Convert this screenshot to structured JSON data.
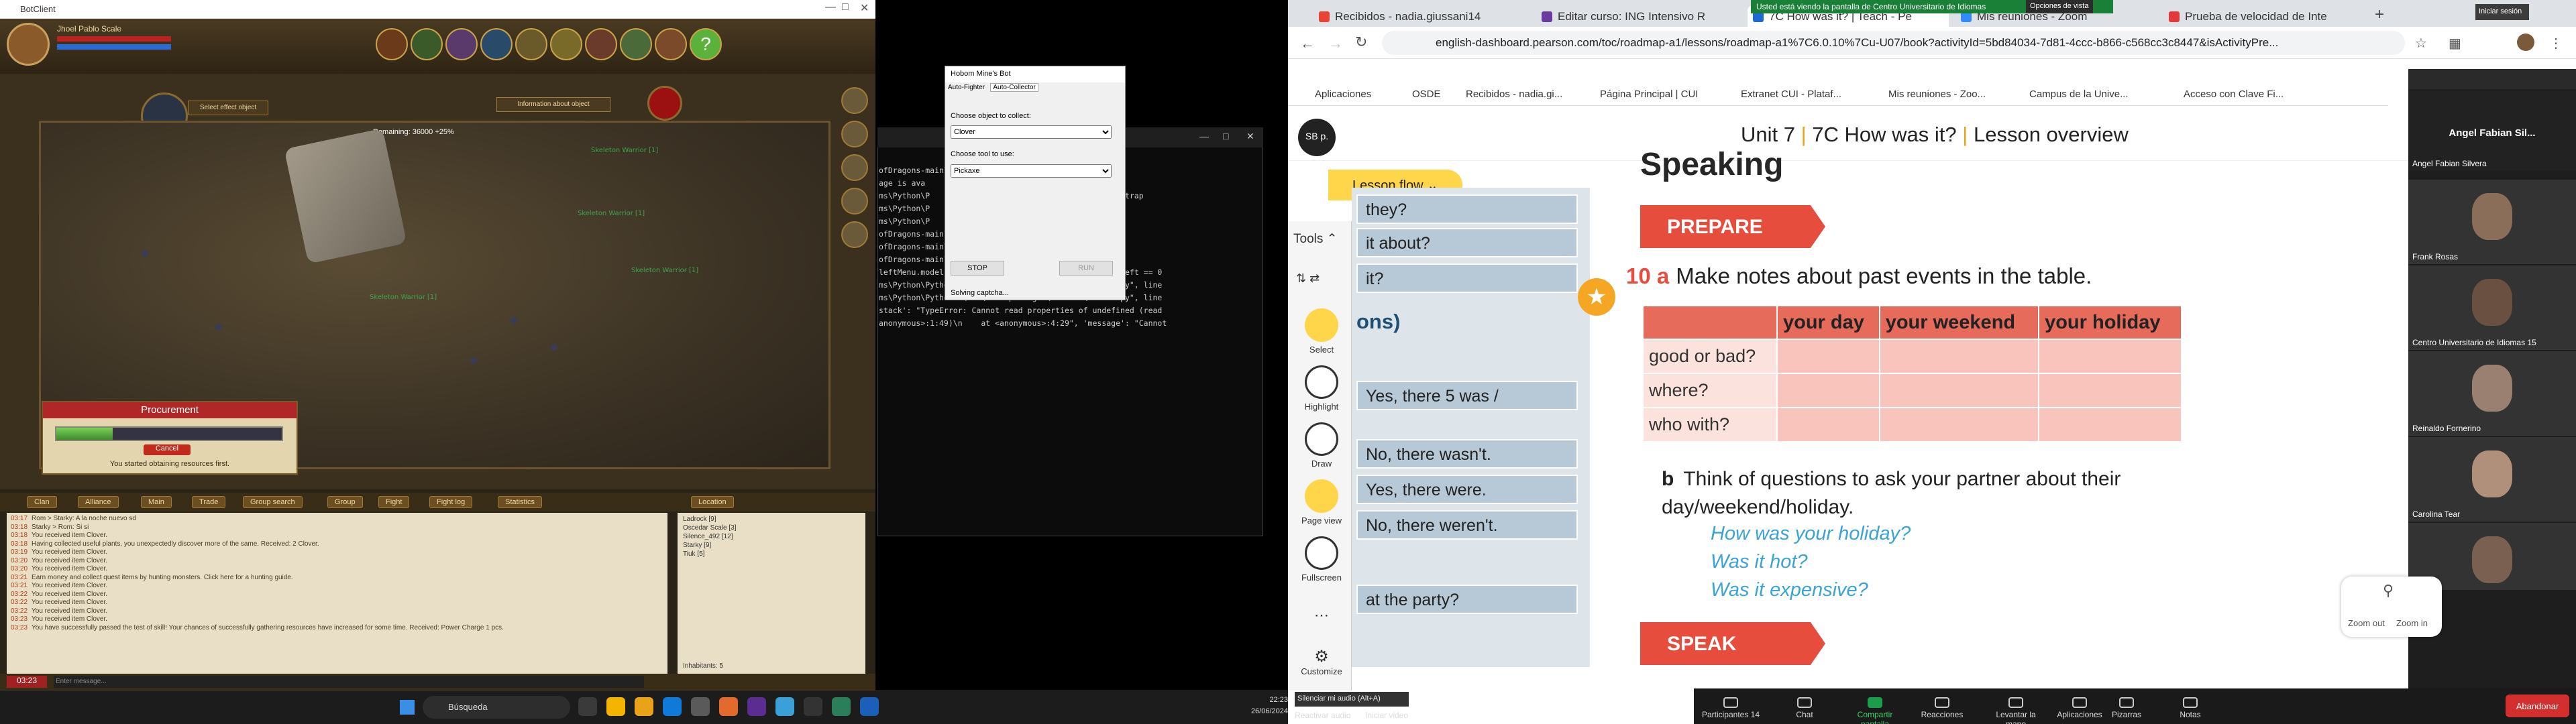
{
  "game": {
    "title": "BotClient",
    "player_name": "Jhoel Pablo Scale",
    "remaining": "Remaining: 36000 +25%",
    "select_object": "Select effect object",
    "info_object": "Information about object",
    "enemies": [
      "Skeleton Warrior [1]",
      "Skeleton Warrior [1]",
      "Skeleton Warrior [1]",
      "Skeleton Warrior [1]"
    ],
    "procurement": {
      "title": "Procurement",
      "cancel": "Cancel",
      "message": "You started obtaining resources first.",
      "progress": 0.25
    },
    "chat_tabs": [
      "Clan",
      "Alliance",
      "Main",
      "Trade",
      "Group search",
      "Group",
      "Fight",
      "Fight log",
      "Statistics",
      "Location"
    ],
    "chat_lines": [
      {
        "time": "03:17",
        "text": "Rom > Starky: A la noche nuevo sd"
      },
      {
        "time": "03:18",
        "text": "Starky > Rom: Si si"
      },
      {
        "time": "03:18",
        "text": "You received item Clover."
      },
      {
        "time": "03:18",
        "text": "Having collected useful plants, you unexpectedly discover more of the same. Received: 2 Clover."
      },
      {
        "time": "03:19",
        "text": "You received item Clover."
      },
      {
        "time": "03:20",
        "text": "You received item Clover."
      },
      {
        "time": "03:20",
        "text": "You received item Clover."
      },
      {
        "time": "03:21",
        "text": "Earn money and collect quest items by hunting monsters. Click here for a hunting guide."
      },
      {
        "time": "03:21",
        "text": "You received item Clover."
      },
      {
        "time": "03:22",
        "text": "You received item Clover."
      },
      {
        "time": "03:22",
        "text": "You received item Clover."
      },
      {
        "time": "03:22",
        "text": "You received item Clover."
      },
      {
        "time": "03:23",
        "text": "You received item Clover."
      },
      {
        "time": "03:23",
        "text": "You have successfully passed the test of skill! Your chances of successfully gathering resources have increased for some time. Received: Power Charge 1 pcs."
      }
    ],
    "location_list": [
      "Ladrock [9]",
      "Oscedar Scale [3]",
      "Silence_492 [12]",
      "Starky [9]",
      "Tiuk [5]"
    ],
    "inhabitants": "Inhabitants: 5",
    "clock": "03:23",
    "message_placeholder": "Enter message..."
  },
  "bot": {
    "title": "Hobom Mine's Bot",
    "tabs": [
      "Auto-Fighter",
      "Auto-Collector"
    ],
    "collect_label": "Choose object to collect:",
    "collect_value": "Clover",
    "tool_label": "Choose tool to use:",
    "tool_value": "Pickaxe",
    "stop": "STOP",
    "run": "RUN",
    "status": "Solving captcha..."
  },
  "terminal": {
    "lines": [
      "ofDragons-main\\botAlgo.py\", line   captureWin",
      "age is ava",
      "",
      "ms\\Python\\P                          e 973, in _bootstrap",
      "",
      "ms\\Python\\P                          e 910, in run",
      "",
      "ms\\Python\\P                     , in main_loop",
      "ofDragons-main\\botAlgo.py\", line 85, in next",
      "ofDragons-main\\botAlgo.py\", line 246, in fight",
      "ofDragons-main\\botAlgo.py\", line 256, in potReady",
      "leftMenu.model.items['\" + str(self.nextPot) + \"'].cdLeft == 0",
      "ms\\Python\\Python39\\lib\\site-packages\\webview\\window.py\", line",
      "",
      "ms\\Python\\Python39\\lib\\site-packages\\webview\\window.py\", line",
      "",
      "stack': \"TypeError: Cannot read properties of undefined (read",
      "anonymous>:1:49)\\n    at <anonymous>:4:29\", 'message': \"Cannot"
    ]
  },
  "taskbar": {
    "search": "Búsqueda",
    "time": "22:23",
    "date": "26/06/2024"
  },
  "browser": {
    "tabs": [
      "Recibidos - nadia.giussani14",
      "Editar curso: ING Intensivo R",
      "7C How was it? | Teach - Pe",
      "Mis reuniones - Zoom",
      "Prueba de velocidad de Inte"
    ],
    "share_banner": "Usted está viendo la pantalla de Centro Universitario de Idiomas",
    "share_options": "Opciones de vista",
    "login": "Iniciar sesión",
    "url": "english-dashboard.pearson.com/toc/roadmap-a1/lessons/roadmap-a1%7C6.0.10%7Cu-U07/book?activityId=5bd84034-7d81-4ccc-b866-c568cc3c8447&isActivityPre...",
    "bookmarks": [
      "Aplicaciones",
      "OSDE",
      "Recibidos - nadia.gi...",
      "Página Principal | CUI",
      "Extranet CUI - Plataf...",
      "Mis reuniones - Zoo...",
      "Campus de la Unive...",
      "Acceso con Clave Fi..."
    ]
  },
  "lesson": {
    "unit": "Unit 7",
    "section": "7C How was it?",
    "overview": "Lesson overview",
    "flow": "Lesson flow",
    "tools": "Tools",
    "tool_items": [
      "Select",
      "Highlight",
      "Draw",
      "Page view",
      "Fullscreen",
      "Customize"
    ],
    "left_cells": [
      "they?",
      "it about?",
      "it?",
      "Yes, there 5 was /",
      "No, there wasn't.",
      "Yes, there were.",
      "No, there weren't.",
      "at the party?"
    ],
    "left_heading": "ons)",
    "heading": "Speaking",
    "prepare": "PREPARE",
    "speak": "SPEAK",
    "q10_num": "10 a",
    "q10_text": "Make notes about past events in the table.",
    "table_headers": [
      "",
      "your day",
      "your weekend",
      "your holiday"
    ],
    "table_rows": [
      "good or bad?",
      "where?",
      "who with?"
    ],
    "qb_label": "b",
    "qb_text": "Think of questions to ask your partner about their day/weekend/holiday.",
    "examples": [
      "How was your holiday?",
      "Was it hot?",
      "Was it expensive?"
    ]
  },
  "zoom": {
    "participants": [
      "Angel Fabian Sil...",
      "Angel Fabian Silvera",
      "Frank Rosas",
      "Centro Universitario de Idiomas 15",
      "Reinaldo Fornerino",
      "Carolina Tear"
    ],
    "zoom_out": "Zoom out",
    "zoom_in": "Zoom in",
    "mute_info": "Silenciar mi audio (Alt+A)",
    "bottom_left": [
      "Reactivar audio",
      "Iniciar video"
    ],
    "meeting_buttons": [
      "Participantes",
      "Chat",
      "Compartir pantalla",
      "Reacciones",
      "Levantar la mano",
      "Aplicaciones",
      "Pizarras",
      "Notas"
    ],
    "participants_count": "14",
    "end": "Abandonar"
  }
}
